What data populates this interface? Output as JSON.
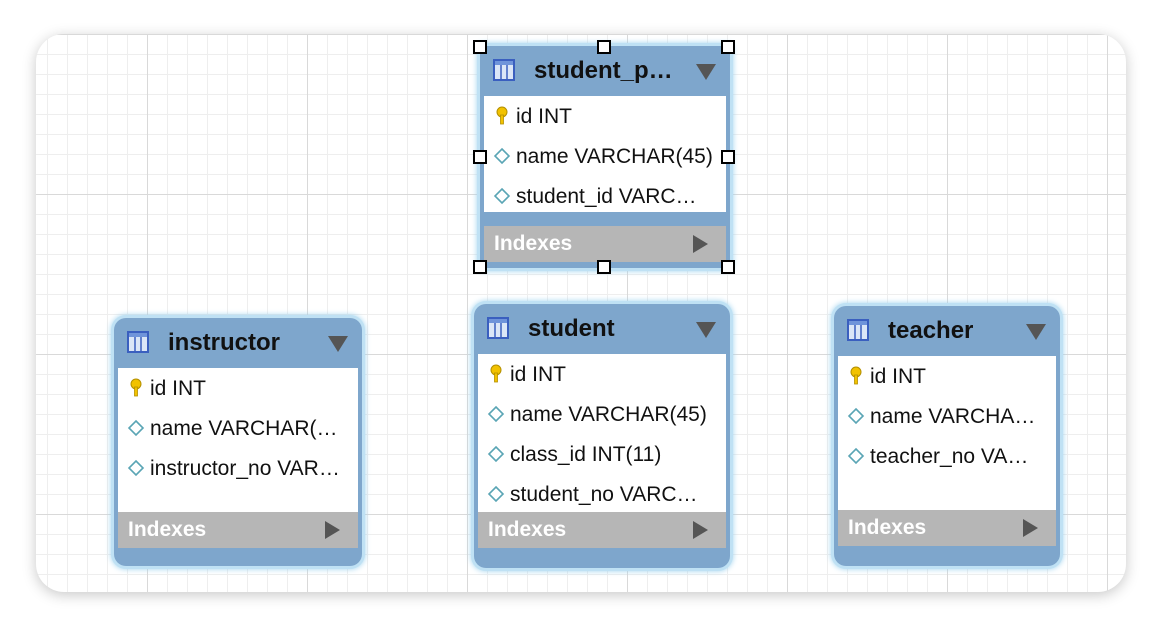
{
  "diagram": {
    "tables": [
      {
        "id": "student_p",
        "title": "student_p…",
        "columns": [
          {
            "icon": "primary-key-icon",
            "text": "id INT"
          },
          {
            "icon": "column-diamond-icon",
            "text": "name VARCHAR(45)"
          },
          {
            "icon": "column-diamond-icon",
            "text": "student_id VARC…"
          }
        ],
        "indexes_label": "Indexes"
      },
      {
        "id": "instructor",
        "title": "instructor",
        "columns": [
          {
            "icon": "primary-key-icon",
            "text": "id INT"
          },
          {
            "icon": "column-diamond-icon",
            "text": "name VARCHAR(…"
          },
          {
            "icon": "column-diamond-icon",
            "text": "instructor_no VAR…"
          }
        ],
        "indexes_label": "Indexes"
      },
      {
        "id": "student",
        "title": "student",
        "columns": [
          {
            "icon": "primary-key-icon",
            "text": "id INT"
          },
          {
            "icon": "column-diamond-icon",
            "text": "name VARCHAR(45)"
          },
          {
            "icon": "column-diamond-icon",
            "text": "class_id INT(11)"
          },
          {
            "icon": "column-diamond-icon",
            "text": "student_no VARC…"
          }
        ],
        "indexes_label": "Indexes"
      },
      {
        "id": "teacher",
        "title": "teacher",
        "columns": [
          {
            "icon": "primary-key-icon",
            "text": "id INT"
          },
          {
            "icon": "column-diamond-icon",
            "text": "name VARCHA…"
          },
          {
            "icon": "column-diamond-icon",
            "text": "teacher_no VA…"
          }
        ],
        "indexes_label": "Indexes"
      }
    ]
  },
  "colors": {
    "header": "#7ea6cc",
    "selection_glow": "#bfe1f4",
    "indexes_bar": "#b6b6b6",
    "key": "#f2c200"
  }
}
